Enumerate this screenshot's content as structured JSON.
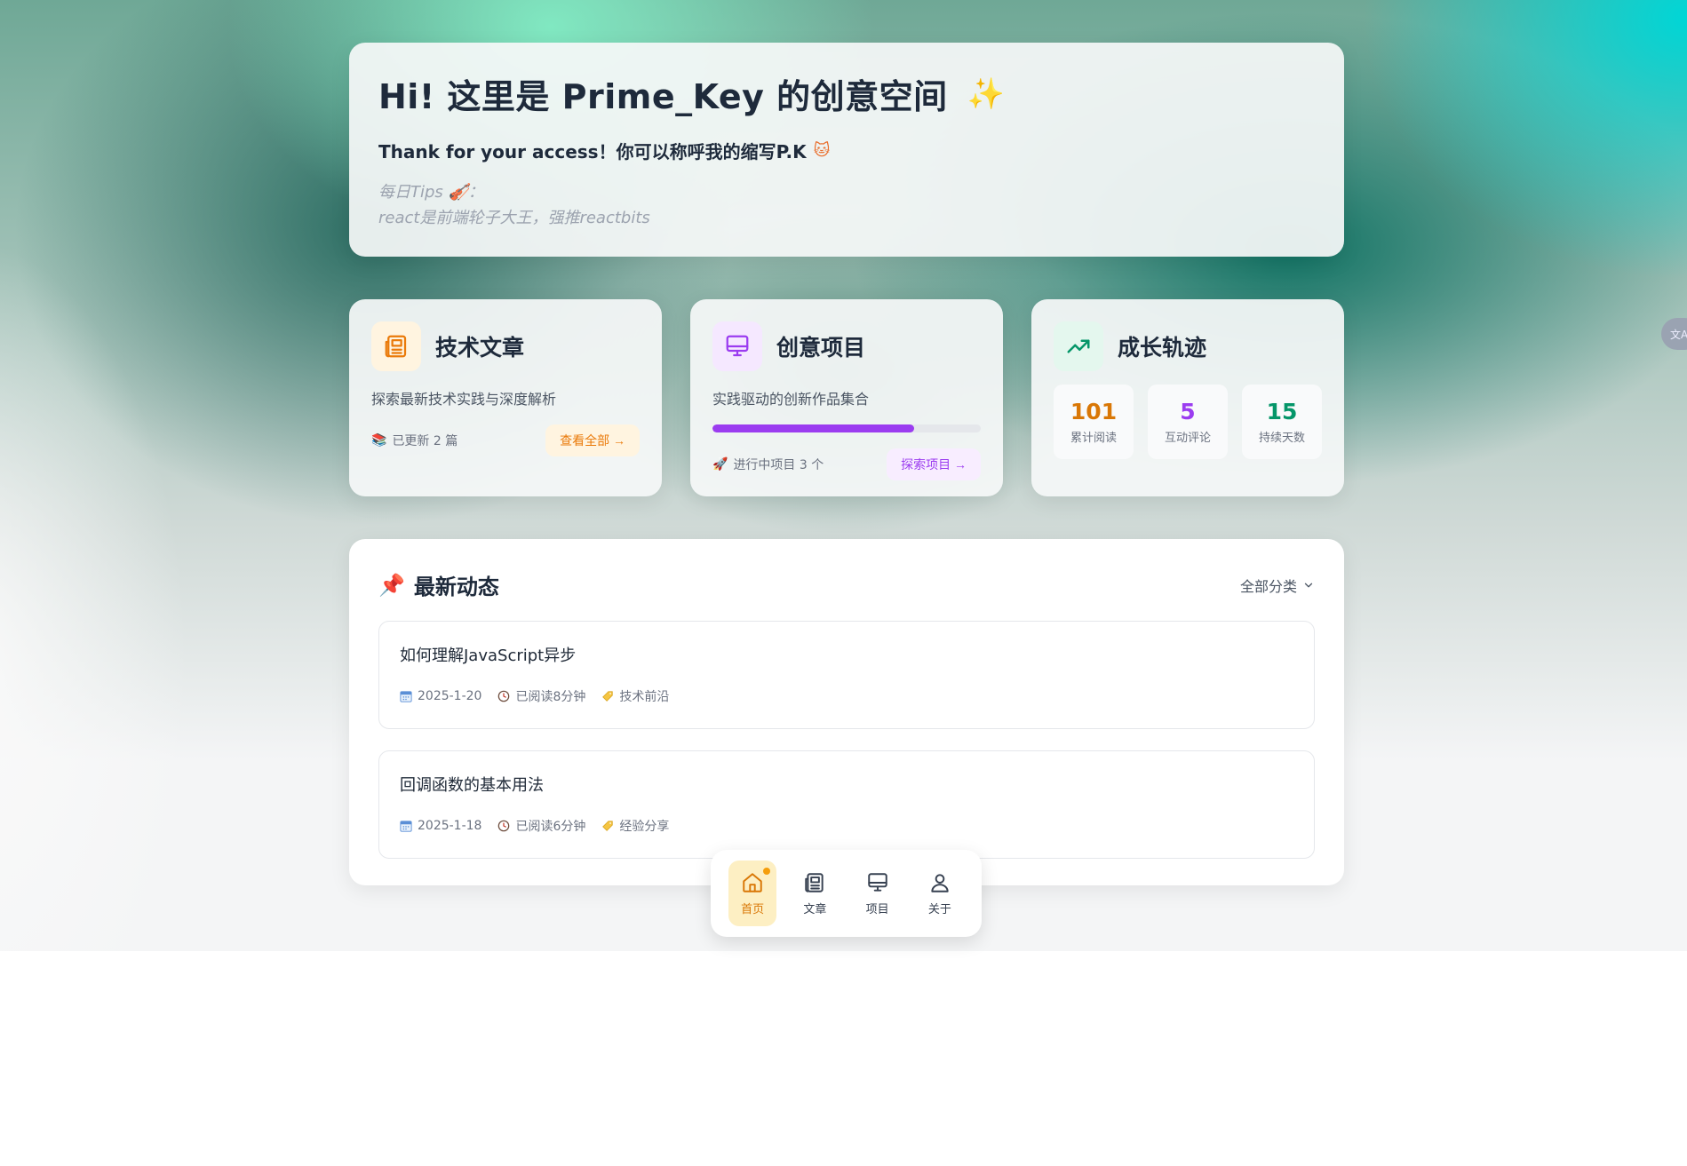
{
  "hero": {
    "title": "Hi! 这里是 Prime_Key 的创意空间",
    "title_emoji": "✨",
    "subtitle": "Thank for your access！你可以称呼我的缩写P.K",
    "subtitle_emoji": "🐱",
    "tips_label": "每日Tips 🎻：",
    "tips_text": "react是前端轮子大王，强推reactbits"
  },
  "cards": {
    "articles": {
      "icon": "newspaper-icon",
      "title": "技术文章",
      "desc": "探索最新技术实践与深度解析",
      "status_emoji": "📚",
      "status": "已更新 2 篇",
      "button": "查看全部 →",
      "accent": "#ea7a0a"
    },
    "projects": {
      "icon": "monitor-icon",
      "title": "创意项目",
      "desc": "实践驱动的创新作品集合",
      "progress": 0.75,
      "status_emoji": "🚀",
      "status": "进行中项目 3 个",
      "button": "探索项目 →",
      "accent": "#9b3cf0"
    },
    "growth": {
      "icon": "trending-up-icon",
      "title": "成长轨迹",
      "stats": [
        {
          "value": "101",
          "label": "累计阅读",
          "color": "#d97706"
        },
        {
          "value": "5",
          "label": "互动评论",
          "color": "#9b3cf0"
        },
        {
          "value": "15",
          "label": "持续天数",
          "color": "#059669"
        }
      ]
    }
  },
  "latest": {
    "title_emoji": "📌",
    "title": "最新动态",
    "filter": "全部分类",
    "posts": [
      {
        "title": "如何理解JavaScript异步",
        "date": "2025-1-20",
        "read": "已阅读8分钟",
        "tag": "技术前沿"
      },
      {
        "title": "回调函数的基本用法",
        "date": "2025-1-18",
        "read": "已阅读6分钟",
        "tag": "经验分享"
      }
    ]
  },
  "nav": {
    "items": [
      {
        "label": "首页",
        "icon": "home-icon"
      },
      {
        "label": "文章",
        "icon": "newspaper-icon"
      },
      {
        "label": "项目",
        "icon": "monitor-icon"
      },
      {
        "label": "关于",
        "icon": "user-icon"
      }
    ]
  },
  "side_tab": {
    "label": "文A"
  }
}
